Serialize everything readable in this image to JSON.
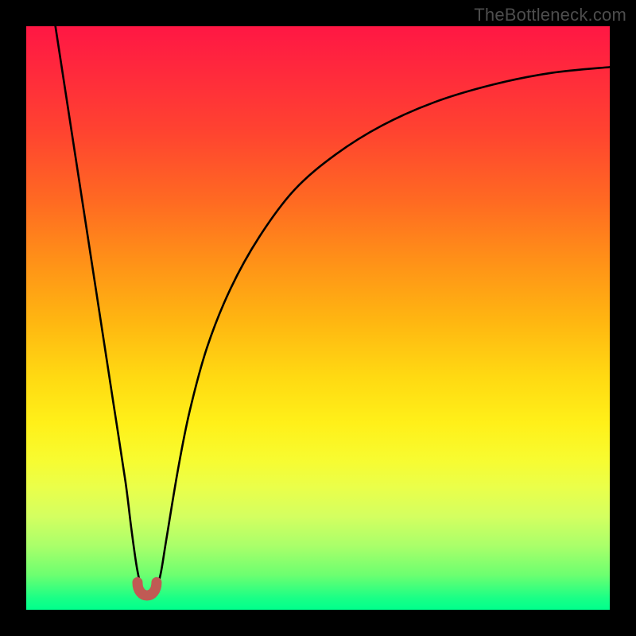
{
  "attribution": "TheBottleneck.com",
  "chart_data": {
    "type": "line",
    "title": "",
    "xlabel": "",
    "ylabel": "",
    "xlim": [
      0,
      100
    ],
    "ylim": [
      0,
      100
    ],
    "series": [
      {
        "name": "bottleneck-curve",
        "x": [
          5,
          7,
          9,
          11,
          13,
          15,
          17,
          18,
          19,
          20,
          21,
          22,
          23,
          24,
          26,
          28,
          31,
          35,
          40,
          46,
          53,
          61,
          70,
          80,
          90,
          100
        ],
        "y": [
          100,
          87,
          74,
          61,
          48,
          35,
          22,
          14,
          7,
          3,
          3,
          3,
          6,
          12,
          24,
          34,
          45,
          55,
          64,
          72,
          78,
          83,
          87,
          90,
          92,
          93
        ]
      }
    ],
    "annotations": [
      {
        "name": "cusp-marker",
        "x": 20.7,
        "y": 2.8,
        "color": "#c05a54"
      }
    ],
    "palette": {
      "top": "#ff1744",
      "mid": "#ffd912",
      "bottom": "#00ff8c",
      "curve": "#000000",
      "marker": "#c05a54"
    }
  }
}
